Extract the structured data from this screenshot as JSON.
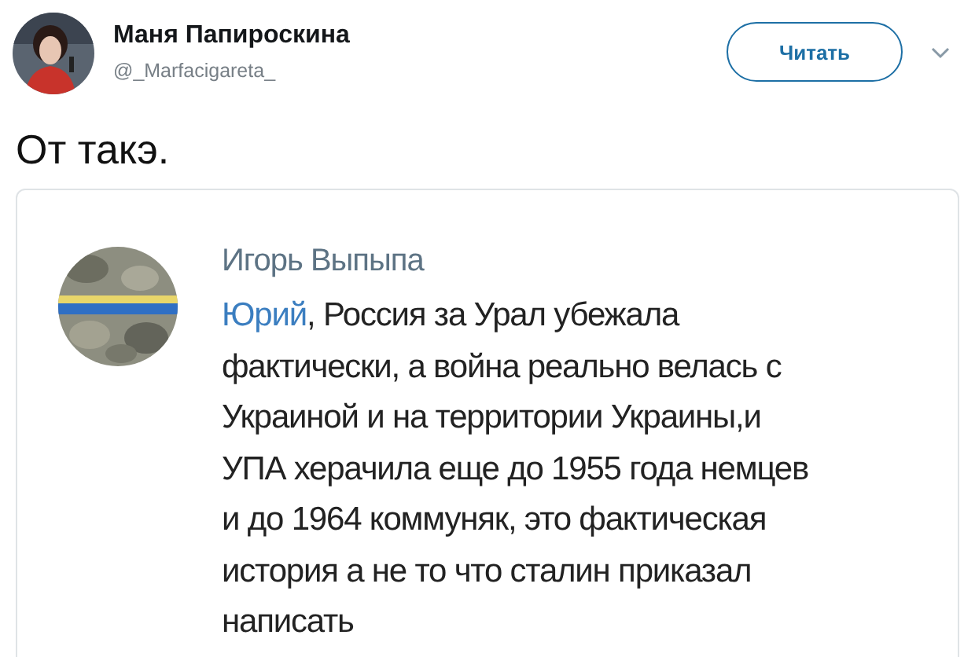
{
  "tweet": {
    "author": "Маня Папироскина",
    "handle": "@_Marfacigareta_",
    "follow_button": "Читать",
    "text": "От такэ.",
    "quoted": {
      "author": "Игорь Выпыпа",
      "mention": "Юрий",
      "lines": [
        ", Россия за Урал убежала",
        "фактически, а война реально велась с",
        "Украиной и на территории Украины,и",
        "УПА херачила еще до 1955 года немцев",
        "и до 1964 коммуняк, это фактическая",
        "история а не то что сталин приказал",
        "написать"
      ]
    }
  }
}
